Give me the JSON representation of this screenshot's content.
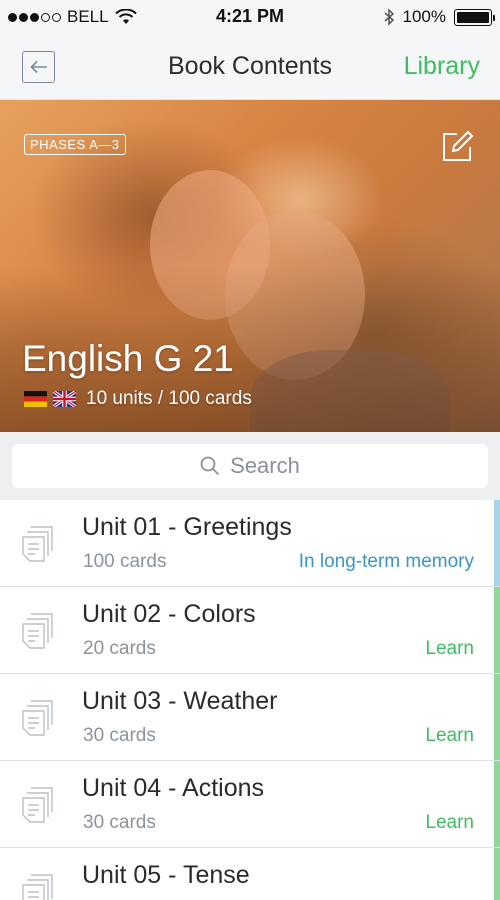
{
  "status_bar": {
    "carrier": "BELL",
    "time": "4:21 PM",
    "battery": "100%"
  },
  "nav": {
    "title": "Book Contents",
    "right_label": "Library"
  },
  "hero": {
    "badge": "PHASES A—3",
    "title": "English G 21",
    "meta": "10 units / 100 cards"
  },
  "search": {
    "placeholder": "Search"
  },
  "units": [
    {
      "title": "Unit 01 - Greetings",
      "count": "100 cards",
      "status": "In long-term memory",
      "status_color": "#3a96c4",
      "bar_color": "#a8d4e9"
    },
    {
      "title": "Unit 02 - Colors",
      "count": "20 cards",
      "status": "Learn",
      "status_color": "#3ebd62",
      "bar_color": "#8fd79a"
    },
    {
      "title": "Unit 03 - Weather",
      "count": "30 cards",
      "status": "Learn",
      "status_color": "#3ebd62",
      "bar_color": "#8fd79a"
    },
    {
      "title": "Unit 04 - Actions",
      "count": "30 cards",
      "status": "Learn",
      "status_color": "#3ebd62",
      "bar_color": "#8fd79a"
    },
    {
      "title": "Unit 05 - Tense",
      "count": "",
      "status": "",
      "status_color": "#3ebd62",
      "bar_color": "#8fd79a"
    }
  ],
  "icons": {
    "back": "arrow-left-icon",
    "edit": "edit-icon",
    "search": "search-icon",
    "unit": "stacked-cards-icon",
    "flag_de": "german-flag-icon",
    "flag_uk": "uk-flag-icon"
  }
}
